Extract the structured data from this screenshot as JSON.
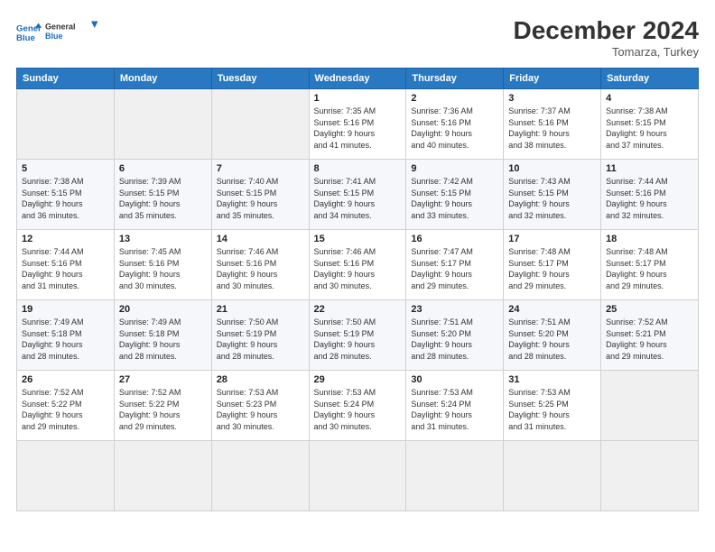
{
  "logo": {
    "line1": "General",
    "line2": "Blue"
  },
  "title": "December 2024",
  "location": "Tomarza, Turkey",
  "weekdays": [
    "Sunday",
    "Monday",
    "Tuesday",
    "Wednesday",
    "Thursday",
    "Friday",
    "Saturday"
  ],
  "days": [
    {
      "num": "",
      "info": ""
    },
    {
      "num": "",
      "info": ""
    },
    {
      "num": "",
      "info": ""
    },
    {
      "num": "1",
      "info": "Sunrise: 7:35 AM\nSunset: 5:16 PM\nDaylight: 9 hours\nand 41 minutes."
    },
    {
      "num": "2",
      "info": "Sunrise: 7:36 AM\nSunset: 5:16 PM\nDaylight: 9 hours\nand 40 minutes."
    },
    {
      "num": "3",
      "info": "Sunrise: 7:37 AM\nSunset: 5:16 PM\nDaylight: 9 hours\nand 38 minutes."
    },
    {
      "num": "4",
      "info": "Sunrise: 7:38 AM\nSunset: 5:15 PM\nDaylight: 9 hours\nand 37 minutes."
    },
    {
      "num": "5",
      "info": "Sunrise: 7:38 AM\nSunset: 5:15 PM\nDaylight: 9 hours\nand 36 minutes."
    },
    {
      "num": "6",
      "info": "Sunrise: 7:39 AM\nSunset: 5:15 PM\nDaylight: 9 hours\nand 35 minutes."
    },
    {
      "num": "7",
      "info": "Sunrise: 7:40 AM\nSunset: 5:15 PM\nDaylight: 9 hours\nand 35 minutes."
    },
    {
      "num": "8",
      "info": "Sunrise: 7:41 AM\nSunset: 5:15 PM\nDaylight: 9 hours\nand 34 minutes."
    },
    {
      "num": "9",
      "info": "Sunrise: 7:42 AM\nSunset: 5:15 PM\nDaylight: 9 hours\nand 33 minutes."
    },
    {
      "num": "10",
      "info": "Sunrise: 7:43 AM\nSunset: 5:15 PM\nDaylight: 9 hours\nand 32 minutes."
    },
    {
      "num": "11",
      "info": "Sunrise: 7:44 AM\nSunset: 5:16 PM\nDaylight: 9 hours\nand 32 minutes."
    },
    {
      "num": "12",
      "info": "Sunrise: 7:44 AM\nSunset: 5:16 PM\nDaylight: 9 hours\nand 31 minutes."
    },
    {
      "num": "13",
      "info": "Sunrise: 7:45 AM\nSunset: 5:16 PM\nDaylight: 9 hours\nand 30 minutes."
    },
    {
      "num": "14",
      "info": "Sunrise: 7:46 AM\nSunset: 5:16 PM\nDaylight: 9 hours\nand 30 minutes."
    },
    {
      "num": "15",
      "info": "Sunrise: 7:46 AM\nSunset: 5:16 PM\nDaylight: 9 hours\nand 30 minutes."
    },
    {
      "num": "16",
      "info": "Sunrise: 7:47 AM\nSunset: 5:17 PM\nDaylight: 9 hours\nand 29 minutes."
    },
    {
      "num": "17",
      "info": "Sunrise: 7:48 AM\nSunset: 5:17 PM\nDaylight: 9 hours\nand 29 minutes."
    },
    {
      "num": "18",
      "info": "Sunrise: 7:48 AM\nSunset: 5:17 PM\nDaylight: 9 hours\nand 29 minutes."
    },
    {
      "num": "19",
      "info": "Sunrise: 7:49 AM\nSunset: 5:18 PM\nDaylight: 9 hours\nand 28 minutes."
    },
    {
      "num": "20",
      "info": "Sunrise: 7:49 AM\nSunset: 5:18 PM\nDaylight: 9 hours\nand 28 minutes."
    },
    {
      "num": "21",
      "info": "Sunrise: 7:50 AM\nSunset: 5:19 PM\nDaylight: 9 hours\nand 28 minutes."
    },
    {
      "num": "22",
      "info": "Sunrise: 7:50 AM\nSunset: 5:19 PM\nDaylight: 9 hours\nand 28 minutes."
    },
    {
      "num": "23",
      "info": "Sunrise: 7:51 AM\nSunset: 5:20 PM\nDaylight: 9 hours\nand 28 minutes."
    },
    {
      "num": "24",
      "info": "Sunrise: 7:51 AM\nSunset: 5:20 PM\nDaylight: 9 hours\nand 28 minutes."
    },
    {
      "num": "25",
      "info": "Sunrise: 7:52 AM\nSunset: 5:21 PM\nDaylight: 9 hours\nand 29 minutes."
    },
    {
      "num": "26",
      "info": "Sunrise: 7:52 AM\nSunset: 5:22 PM\nDaylight: 9 hours\nand 29 minutes."
    },
    {
      "num": "27",
      "info": "Sunrise: 7:52 AM\nSunset: 5:22 PM\nDaylight: 9 hours\nand 29 minutes."
    },
    {
      "num": "28",
      "info": "Sunrise: 7:53 AM\nSunset: 5:23 PM\nDaylight: 9 hours\nand 30 minutes."
    },
    {
      "num": "29",
      "info": "Sunrise: 7:53 AM\nSunset: 5:24 PM\nDaylight: 9 hours\nand 30 minutes."
    },
    {
      "num": "30",
      "info": "Sunrise: 7:53 AM\nSunset: 5:24 PM\nDaylight: 9 hours\nand 31 minutes."
    },
    {
      "num": "31",
      "info": "Sunrise: 7:53 AM\nSunset: 5:25 PM\nDaylight: 9 hours\nand 31 minutes."
    },
    {
      "num": "",
      "info": ""
    },
    {
      "num": "",
      "info": ""
    },
    {
      "num": "",
      "info": ""
    },
    {
      "num": "",
      "info": ""
    }
  ]
}
